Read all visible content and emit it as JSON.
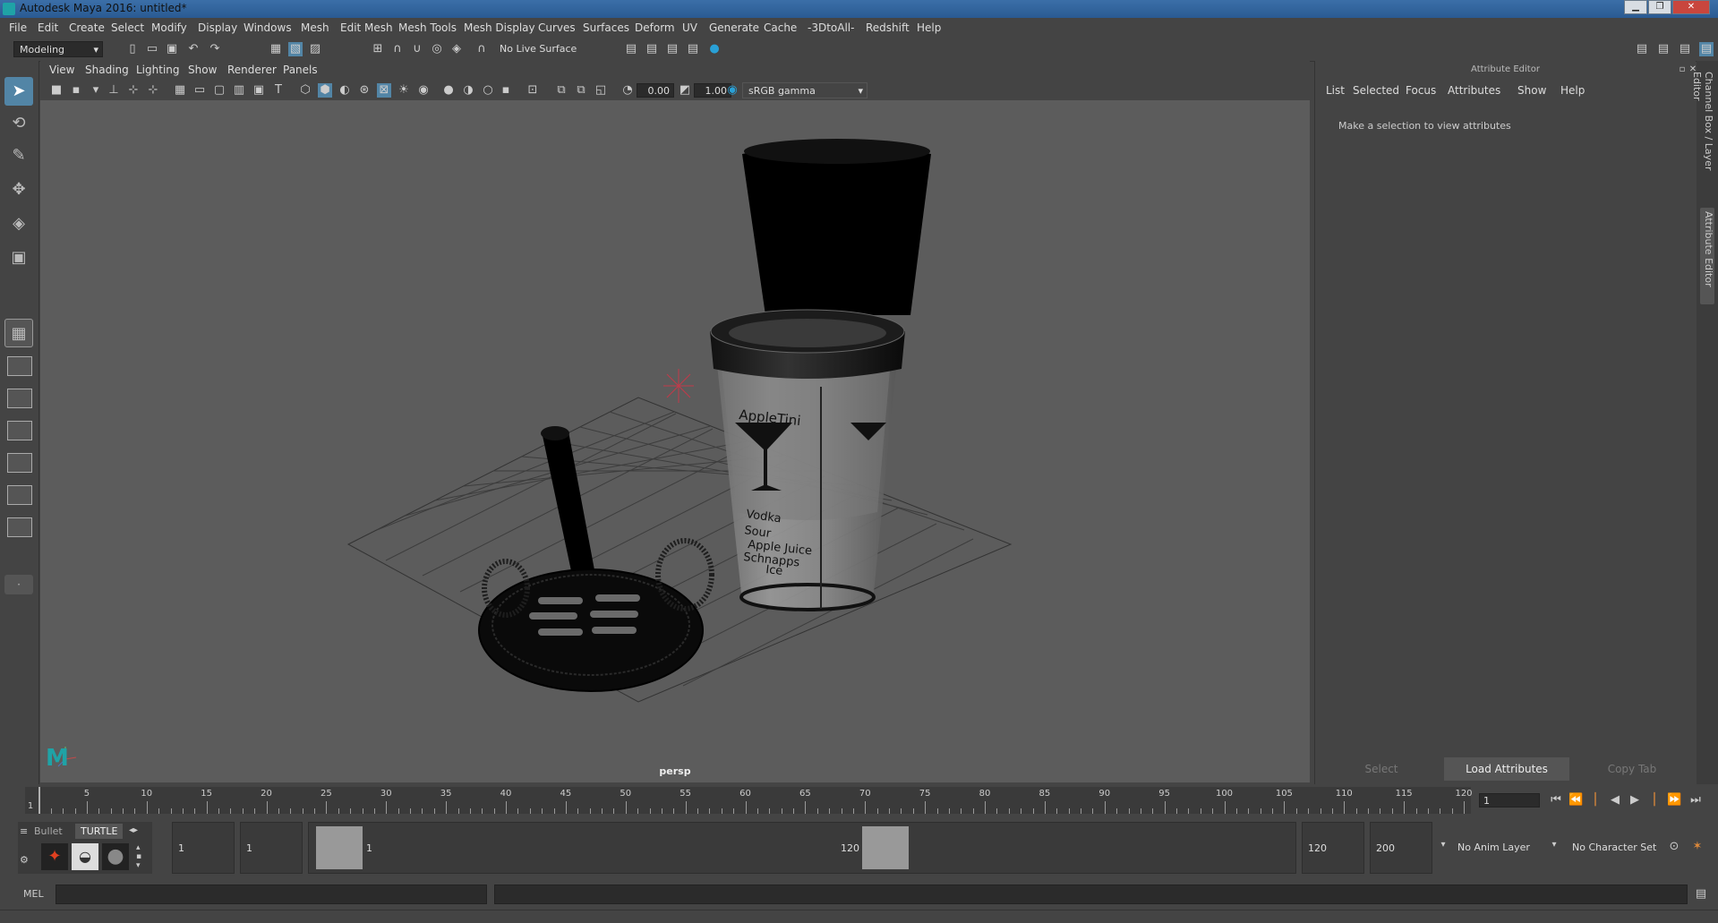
{
  "window": {
    "title": "Autodesk Maya 2016: untitled*"
  },
  "menubar": [
    "File",
    "Edit",
    "Create",
    "Select",
    "Modify",
    "Display",
    "Windows",
    "Mesh",
    "Edit Mesh",
    "Mesh Tools",
    "Mesh Display",
    "Curves",
    "Surfaces",
    "Deform",
    "UV",
    "Generate",
    "Cache",
    "-3DtoAll-",
    "Redshift",
    "Help"
  ],
  "statusline": {
    "menuset": "Modeling",
    "live_surface": "No Live Surface"
  },
  "viewport": {
    "menus": [
      "View",
      "Shading",
      "Lighting",
      "Show",
      "Renderer",
      "Panels"
    ],
    "exposure": "0.00",
    "gamma": "1.00",
    "color_space": "sRGB gamma",
    "camera_label": "persp",
    "cup_labels": {
      "title": "AppleTini",
      "line1": "Vodka",
      "line2": "Sour",
      "line3": "Apple Juice",
      "line4": "Schnapps",
      "line5": "Ice"
    }
  },
  "attribute_editor": {
    "header": "Attribute Editor",
    "menus": [
      "List",
      "Selected",
      "Focus",
      "Attributes",
      "Show",
      "Help"
    ],
    "message": "Make a selection to view attributes",
    "buttons": {
      "select": "Select",
      "load": "Load Attributes",
      "copy": "Copy Tab"
    }
  },
  "side_tabs": {
    "channel_box": "Channel Box / Layer Editor",
    "attribute_editor": "Attribute Editor"
  },
  "timeslider": {
    "ticks": [
      5,
      10,
      15,
      20,
      25,
      30,
      35,
      40,
      45,
      50,
      55,
      60,
      65,
      70,
      75,
      80,
      85,
      90,
      95,
      100,
      105,
      110,
      115,
      120
    ],
    "start_label": "1",
    "current_frame": "1"
  },
  "range": {
    "start": "1",
    "start2": "1",
    "range_start": "1",
    "range_end": "120",
    "end": "120",
    "end2": "200",
    "anim_layer": "No Anim Layer",
    "char_set": "No Character Set"
  },
  "shelf": {
    "tab1": "Bullet",
    "tab2": "TURTLE"
  },
  "cmdline": {
    "label": "MEL"
  }
}
